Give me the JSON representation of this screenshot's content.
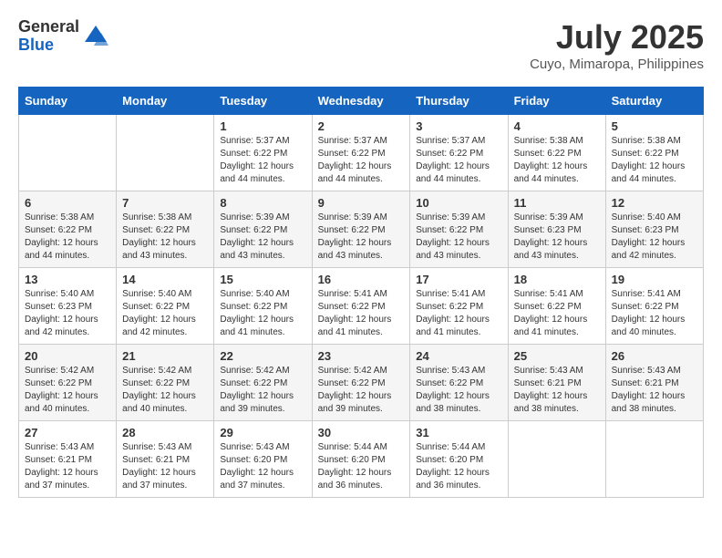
{
  "logo": {
    "general": "General",
    "blue": "Blue"
  },
  "title": "July 2025",
  "location": "Cuyo, Mimaropa, Philippines",
  "days_of_week": [
    "Sunday",
    "Monday",
    "Tuesday",
    "Wednesday",
    "Thursday",
    "Friday",
    "Saturday"
  ],
  "weeks": [
    [
      {
        "day": "",
        "content": ""
      },
      {
        "day": "",
        "content": ""
      },
      {
        "day": "1",
        "content": "Sunrise: 5:37 AM\nSunset: 6:22 PM\nDaylight: 12 hours\nand 44 minutes."
      },
      {
        "day": "2",
        "content": "Sunrise: 5:37 AM\nSunset: 6:22 PM\nDaylight: 12 hours\nand 44 minutes."
      },
      {
        "day": "3",
        "content": "Sunrise: 5:37 AM\nSunset: 6:22 PM\nDaylight: 12 hours\nand 44 minutes."
      },
      {
        "day": "4",
        "content": "Sunrise: 5:38 AM\nSunset: 6:22 PM\nDaylight: 12 hours\nand 44 minutes."
      },
      {
        "day": "5",
        "content": "Sunrise: 5:38 AM\nSunset: 6:22 PM\nDaylight: 12 hours\nand 44 minutes."
      }
    ],
    [
      {
        "day": "6",
        "content": "Sunrise: 5:38 AM\nSunset: 6:22 PM\nDaylight: 12 hours\nand 44 minutes."
      },
      {
        "day": "7",
        "content": "Sunrise: 5:38 AM\nSunset: 6:22 PM\nDaylight: 12 hours\nand 43 minutes."
      },
      {
        "day": "8",
        "content": "Sunrise: 5:39 AM\nSunset: 6:22 PM\nDaylight: 12 hours\nand 43 minutes."
      },
      {
        "day": "9",
        "content": "Sunrise: 5:39 AM\nSunset: 6:22 PM\nDaylight: 12 hours\nand 43 minutes."
      },
      {
        "day": "10",
        "content": "Sunrise: 5:39 AM\nSunset: 6:22 PM\nDaylight: 12 hours\nand 43 minutes."
      },
      {
        "day": "11",
        "content": "Sunrise: 5:39 AM\nSunset: 6:23 PM\nDaylight: 12 hours\nand 43 minutes."
      },
      {
        "day": "12",
        "content": "Sunrise: 5:40 AM\nSunset: 6:23 PM\nDaylight: 12 hours\nand 42 minutes."
      }
    ],
    [
      {
        "day": "13",
        "content": "Sunrise: 5:40 AM\nSunset: 6:23 PM\nDaylight: 12 hours\nand 42 minutes."
      },
      {
        "day": "14",
        "content": "Sunrise: 5:40 AM\nSunset: 6:22 PM\nDaylight: 12 hours\nand 42 minutes."
      },
      {
        "day": "15",
        "content": "Sunrise: 5:40 AM\nSunset: 6:22 PM\nDaylight: 12 hours\nand 41 minutes."
      },
      {
        "day": "16",
        "content": "Sunrise: 5:41 AM\nSunset: 6:22 PM\nDaylight: 12 hours\nand 41 minutes."
      },
      {
        "day": "17",
        "content": "Sunrise: 5:41 AM\nSunset: 6:22 PM\nDaylight: 12 hours\nand 41 minutes."
      },
      {
        "day": "18",
        "content": "Sunrise: 5:41 AM\nSunset: 6:22 PM\nDaylight: 12 hours\nand 41 minutes."
      },
      {
        "day": "19",
        "content": "Sunrise: 5:41 AM\nSunset: 6:22 PM\nDaylight: 12 hours\nand 40 minutes."
      }
    ],
    [
      {
        "day": "20",
        "content": "Sunrise: 5:42 AM\nSunset: 6:22 PM\nDaylight: 12 hours\nand 40 minutes."
      },
      {
        "day": "21",
        "content": "Sunrise: 5:42 AM\nSunset: 6:22 PM\nDaylight: 12 hours\nand 40 minutes."
      },
      {
        "day": "22",
        "content": "Sunrise: 5:42 AM\nSunset: 6:22 PM\nDaylight: 12 hours\nand 39 minutes."
      },
      {
        "day": "23",
        "content": "Sunrise: 5:42 AM\nSunset: 6:22 PM\nDaylight: 12 hours\nand 39 minutes."
      },
      {
        "day": "24",
        "content": "Sunrise: 5:43 AM\nSunset: 6:22 PM\nDaylight: 12 hours\nand 38 minutes."
      },
      {
        "day": "25",
        "content": "Sunrise: 5:43 AM\nSunset: 6:21 PM\nDaylight: 12 hours\nand 38 minutes."
      },
      {
        "day": "26",
        "content": "Sunrise: 5:43 AM\nSunset: 6:21 PM\nDaylight: 12 hours\nand 38 minutes."
      }
    ],
    [
      {
        "day": "27",
        "content": "Sunrise: 5:43 AM\nSunset: 6:21 PM\nDaylight: 12 hours\nand 37 minutes."
      },
      {
        "day": "28",
        "content": "Sunrise: 5:43 AM\nSunset: 6:21 PM\nDaylight: 12 hours\nand 37 minutes."
      },
      {
        "day": "29",
        "content": "Sunrise: 5:43 AM\nSunset: 6:20 PM\nDaylight: 12 hours\nand 37 minutes."
      },
      {
        "day": "30",
        "content": "Sunrise: 5:44 AM\nSunset: 6:20 PM\nDaylight: 12 hours\nand 36 minutes."
      },
      {
        "day": "31",
        "content": "Sunrise: 5:44 AM\nSunset: 6:20 PM\nDaylight: 12 hours\nand 36 minutes."
      },
      {
        "day": "",
        "content": ""
      },
      {
        "day": "",
        "content": ""
      }
    ]
  ]
}
